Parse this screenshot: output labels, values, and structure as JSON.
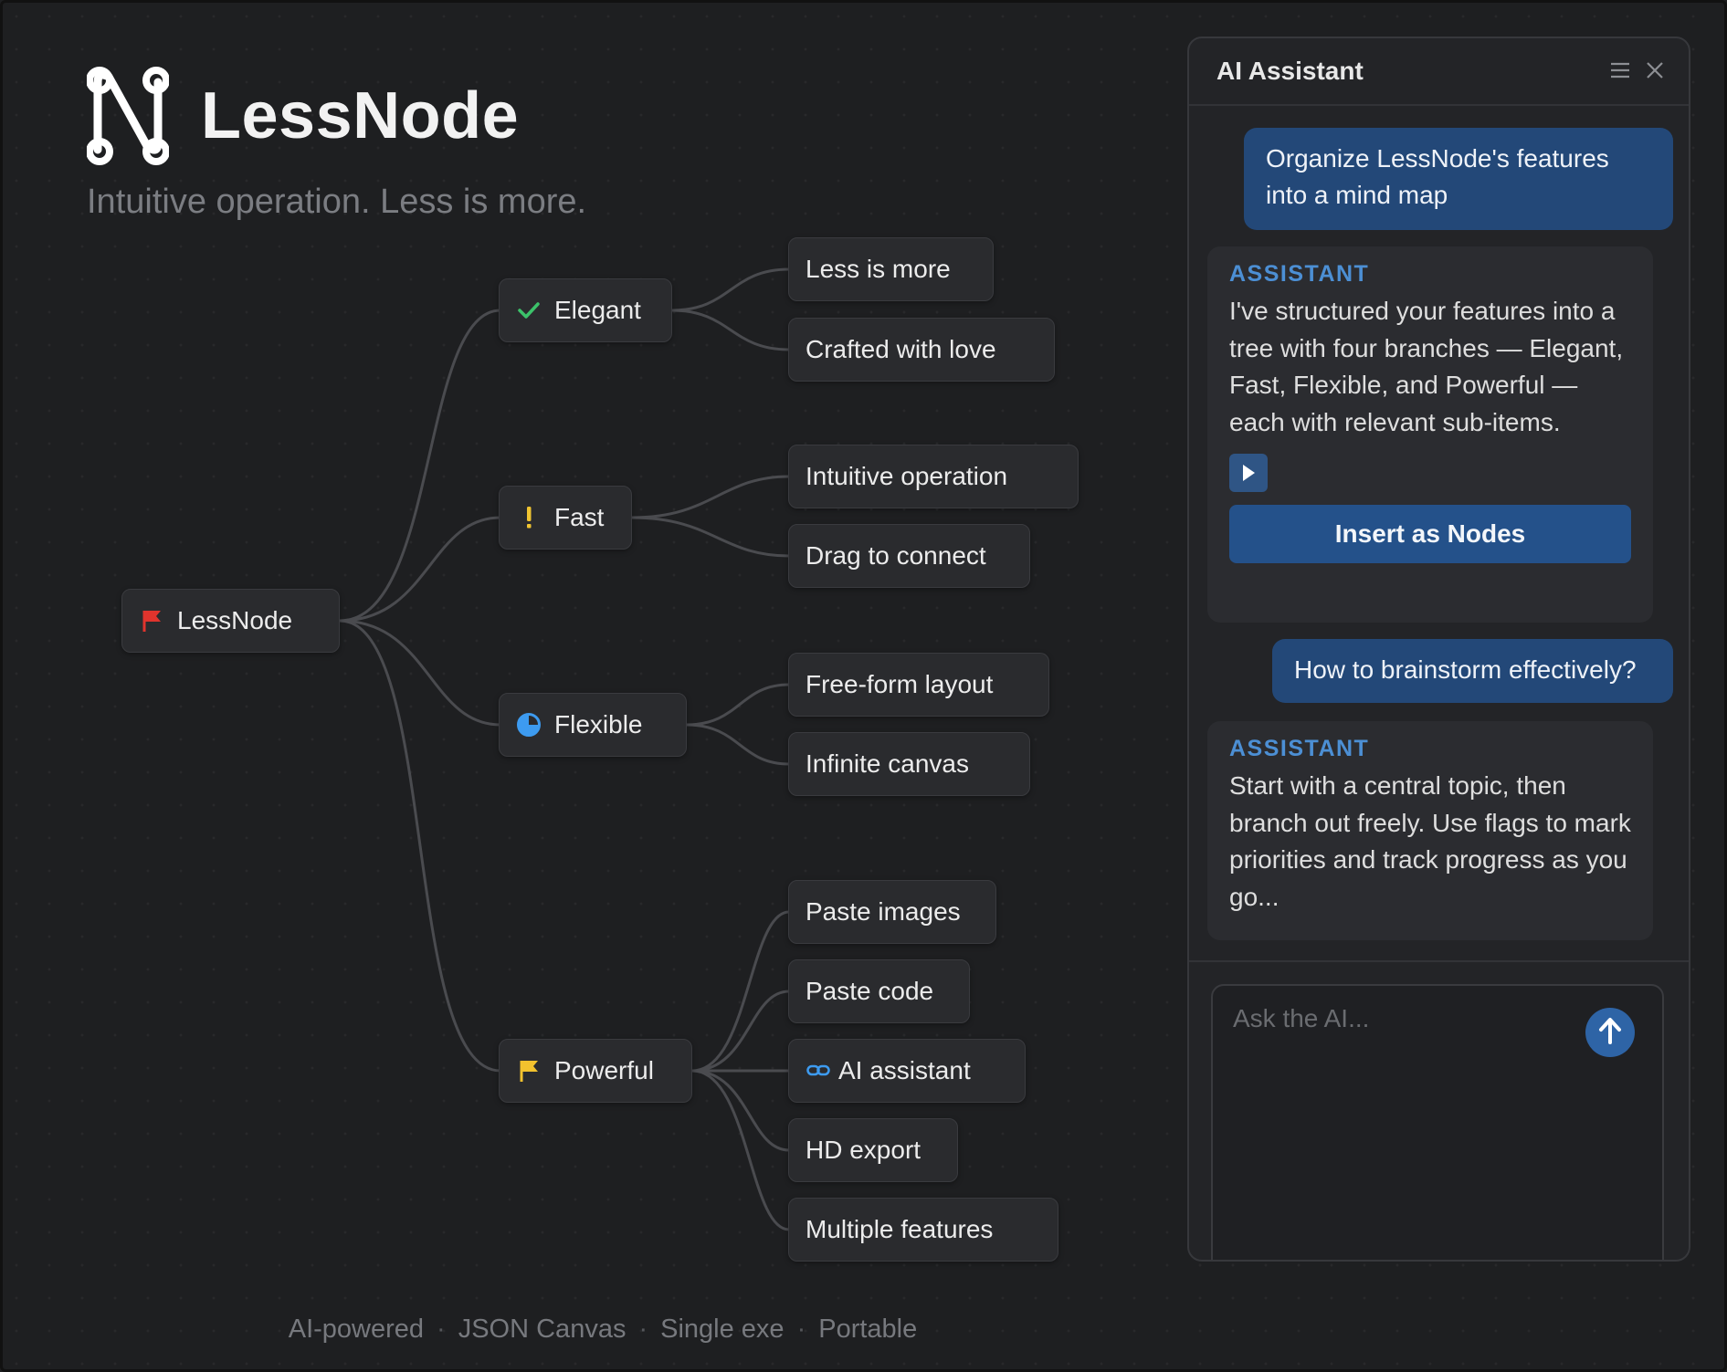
{
  "app": {
    "title": "LessNode",
    "tagline": "Intuitive operation. Less is more."
  },
  "mindmap": {
    "root": {
      "label": "LessNode",
      "icon": "red-flag-icon"
    },
    "branches": [
      {
        "label": "Elegant",
        "icon": "check-icon",
        "children": [
          "Less is more",
          "Crafted with love"
        ]
      },
      {
        "label": "Fast",
        "icon": "exclamation-icon",
        "children": [
          "Intuitive operation",
          "Drag to connect"
        ]
      },
      {
        "label": "Flexible",
        "icon": "half-circle-progress-icon",
        "children": [
          "Free-form layout",
          "Infinite canvas"
        ]
      },
      {
        "label": "Powerful",
        "icon": "yellow-flag-icon",
        "children": [
          "Paste images",
          "Paste code",
          "AI assistant",
          "HD export",
          "Multiple features"
        ]
      }
    ],
    "colors": {
      "link": "#4a4b4f",
      "check": "#3cc26a",
      "exclaim": "#f0c431",
      "progress": "#3d9bf0",
      "red_flag": "#e0342d",
      "yellow_flag": "#f2c22e",
      "link_icon": "#3d9bf0"
    }
  },
  "footer": {
    "items": [
      "AI-powered",
      "JSON Canvas",
      "Single exe",
      "Portable"
    ],
    "separator": "·"
  },
  "assistant": {
    "title": "AI Assistant",
    "messages": [
      {
        "role": "user",
        "text": "Organize LessNode's features into a mind map"
      },
      {
        "role": "assistant",
        "label": "ASSISTANT",
        "text": "I've structured your features into a tree with four branches — Elegant, Fast, Flexible, and Powerful — each with relevant sub-items.",
        "action": "Insert as Nodes"
      },
      {
        "role": "user",
        "text": "How to brainstorm effectively?"
      },
      {
        "role": "assistant",
        "label": "ASSISTANT",
        "text": "Start with a central topic, then branch out freely. Use flags to mark priorities and track progress as you go..."
      }
    ],
    "input_placeholder": "Ask the AI...",
    "accent": "#234878"
  }
}
